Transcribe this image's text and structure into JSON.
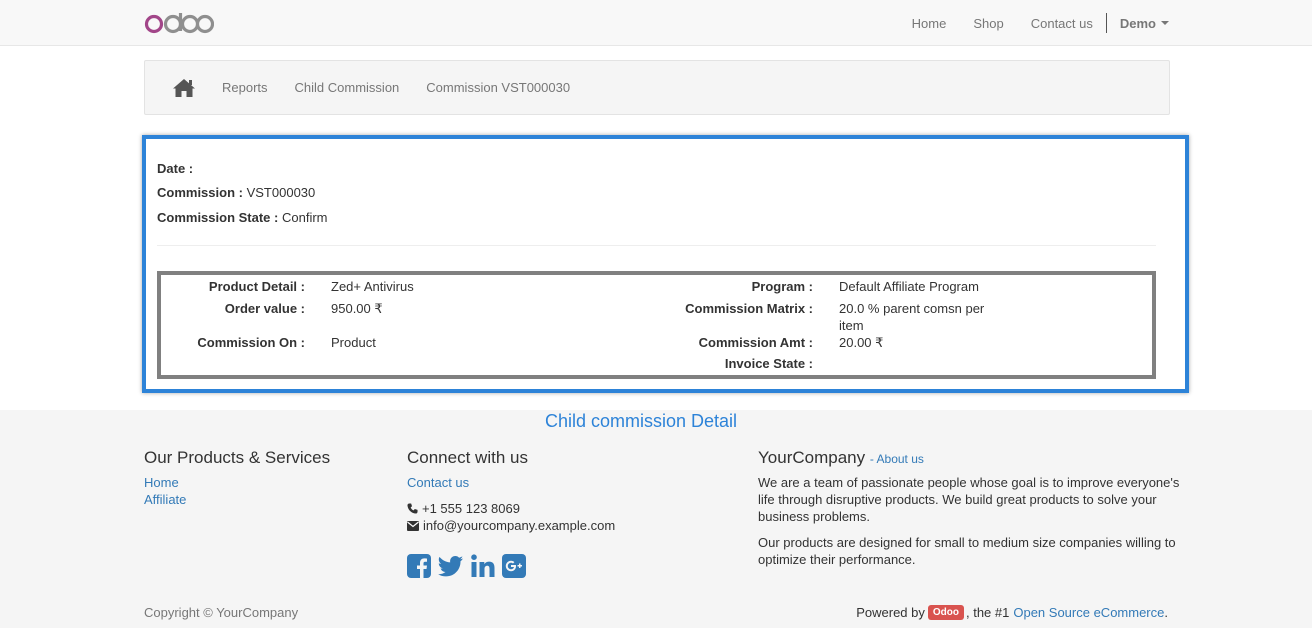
{
  "navbar": {
    "brand": "odoo",
    "links": [
      "Home",
      "Shop",
      "Contact us"
    ],
    "user": "Demo"
  },
  "breadcrumb": {
    "items": [
      "Reports",
      "Child Commission",
      "Commission VST000030"
    ]
  },
  "commission": {
    "date_label": "Date :",
    "date_value": "",
    "commission_label": "Commission :",
    "commission_value": "VST000030",
    "state_label": "Commission State :",
    "state_value": "Confirm",
    "details": {
      "product_detail_label": "Product Detail :",
      "product_detail_value": "Zed+ Antivirus",
      "order_value_label": "Order value :",
      "order_value_value": "950.00 ₹",
      "commission_on_label": "Commission On :",
      "commission_on_value": "Product",
      "program_label": "Program :",
      "program_value": "Default Affiliate Program",
      "matrix_label": "Commission Matrix :",
      "matrix_value_1": "20.0 % parent comsn per",
      "matrix_value_2": "item",
      "amt_label": "Commission Amt :",
      "amt_value": "20.00 ₹",
      "invoice_label": "Invoice State :",
      "invoice_value": ""
    }
  },
  "caption": "Child commission Detail",
  "footer": {
    "products_title": "Our Products & Services",
    "products_links": [
      "Home",
      "Affiliate"
    ],
    "connect_title": "Connect with us",
    "contact_link": "Contact us",
    "phone": "+1 555 123 8069",
    "email": "info@yourcompany.example.com",
    "company_title": "YourCompany",
    "about_link": "- About us",
    "about_p1_lines": [
      "We are a team of passionate people whose goal is to improve everyone's",
      "life through disruptive products. We build great products to solve your",
      "business problems."
    ],
    "about_p2_lines": [
      "Our products are designed for small to medium size companies willing to",
      "optimize their performance."
    ],
    "copyright": "Copyright © YourCompany",
    "powered_prefix": "Powered by",
    "powered_badge": "Odoo",
    "powered_mid": ", the #1",
    "powered_link": "Open Source eCommerce",
    "powered_suffix": "."
  },
  "colors": {
    "accent": "#2d83d8",
    "link": "#337ab7",
    "badge": "#d9534f",
    "logo": "#a24689"
  },
  "icons": [
    "home-icon",
    "phone-icon",
    "envelope-icon",
    "facebook-icon",
    "twitter-icon",
    "linkedin-icon",
    "google-plus-icon",
    "caret-down-icon"
  ]
}
